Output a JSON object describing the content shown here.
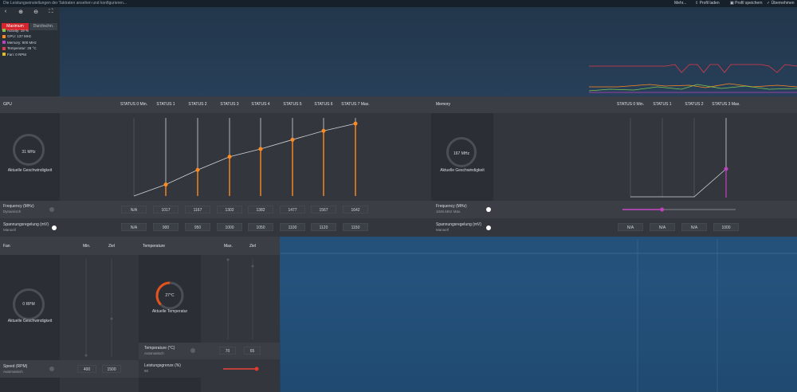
{
  "topbar": {
    "subtitle": "Die Leistungseinstellungen der Taktraten ansehen und konfigurieren...",
    "items": [
      "Mehr...",
      "Profil laden",
      "Profil speichern",
      "Übernehmen"
    ]
  },
  "tools": {
    "icons": [
      "back-icon",
      "zoom-in-icon",
      "zoom-out-icon",
      "fullscreen-icon"
    ],
    "mode_max": "Maximum",
    "mode_avg": "Durchschn."
  },
  "legend": [
    {
      "label": "Activity: 19 %",
      "color": "#7ec850"
    },
    {
      "label": "GPU: 137 MHz",
      "color": "#ff8a1f"
    },
    {
      "label": "Memory: 900 MHz",
      "color": "#c040c0"
    },
    {
      "label": "Temperatur: 28 °C",
      "color": "#e23a4a"
    },
    {
      "label": "Fan: 0 RPM",
      "color": "#e0c020"
    }
  ],
  "gpu": {
    "title": "GPU",
    "states": [
      "STATUS 0 Min.",
      "STATUS 1",
      "STATUS 2",
      "STATUS 3",
      "STATUS 4",
      "STATUS 5",
      "STATUS 6",
      "STATUS 7 Max."
    ],
    "gauge_value": "31 MHz",
    "gauge_label": "Aktuelle Geschwindigkeit",
    "freq_label": "Frequency (MHz)",
    "freq_sub": "Dynamisch",
    "freq_values": [
      "N/A",
      "1017",
      "1167",
      "1302",
      "1382",
      "1477",
      "1567",
      "1642"
    ],
    "volt_label": "Spannungsregelung (mV)",
    "volt_sub": "Manuell",
    "volt_values": [
      "N/A",
      "900",
      "950",
      "1000",
      "1050",
      "1100",
      "1120",
      "1150"
    ]
  },
  "memory": {
    "title": "Memory",
    "states": [
      "STATUS 0 Min.",
      "STATUS 1",
      "STATUS 2",
      "STATUS 3 Max."
    ],
    "gauge_value": "167 MHz",
    "gauge_label": "Aktuelle Geschwindigkeit",
    "freq_label": "Frequency (MHz)",
    "freq_sub": "1045 MHz Max.",
    "volt_label": "Spannungsregelung (mV)",
    "volt_sub": "Manuell",
    "volt_values": [
      "N/A",
      "N/A",
      "N/A",
      "1000"
    ],
    "slider_level": 0.35
  },
  "fan": {
    "title": "Fan",
    "col_min": "Min.",
    "col_target": "Ziel",
    "gauge_value": "0 RPM",
    "gauge_label": "Aktuelle Geschwindigkeit",
    "speed_label": "Speed (RPM)",
    "speed_sub": "Automatisch",
    "speed_min": "400",
    "speed_target": "1500"
  },
  "temperature": {
    "title": "Temperature",
    "col_max": "Max.",
    "col_target": "Ziel",
    "gauge_value": "27°C",
    "gauge_label": "Aktuelle Temperatur",
    "temp_label": "Temperature (°C)",
    "temp_sub": "Automatisch",
    "temp_max": "70",
    "temp_target": "65",
    "power_label": "Leistungsgrenze (%)",
    "power_sub": "50",
    "power_level": 1.0
  },
  "colors": {
    "accent_orange": "#ff8a1f",
    "accent_red": "#d5262e",
    "accent_magenta": "#c040c0"
  }
}
